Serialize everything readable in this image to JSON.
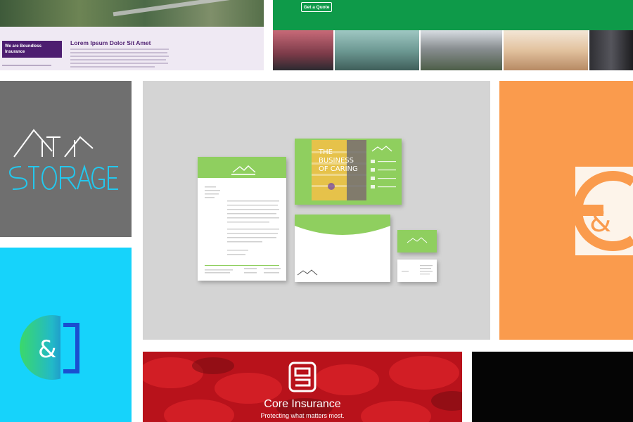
{
  "tiles": {
    "website": {
      "badge_line1": "We are Boundless",
      "badge_line2": "Insurance",
      "heading": "Lorem Ipsum Dolor Sit Amet"
    },
    "green_site": {
      "button_label": "Get a Quote"
    },
    "attic": {
      "logo_word_top": "ATTIC",
      "logo_word_bottom": "STORAGE"
    },
    "stationery": {
      "brochure_line1": "THE",
      "brochure_line2": "BUSINESS",
      "brochure_line3": "OF CARING"
    },
    "core_insurance": {
      "title": "Core Insurance",
      "tagline": "Protecting what matters most."
    }
  },
  "colors": {
    "purple": "#4d1e70",
    "green": "#0e9a49",
    "lime": "#8fcf5e",
    "orange": "#fa9b4d",
    "cyan": "#16d3fb",
    "red": "#b8121b",
    "grey": "#6f6f6f"
  }
}
